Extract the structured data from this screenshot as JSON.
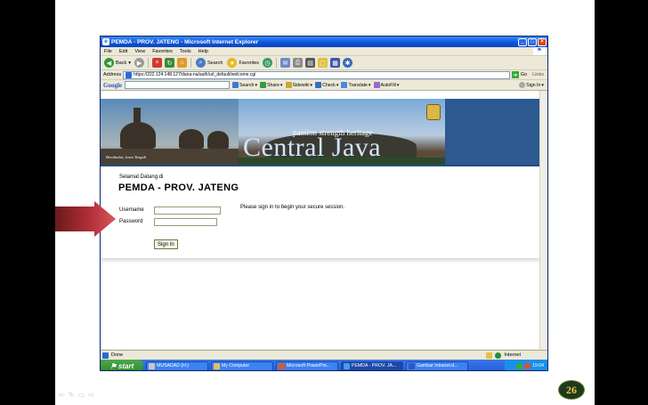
{
  "slide": {
    "page_number": "26",
    "nav_icons": [
      "⇦",
      "✎",
      "▭",
      "⇨"
    ]
  },
  "window": {
    "title": "PEMDA - PROV. JATENG - Microsoft Internet Explorer",
    "controls": [
      "_",
      "□",
      "×"
    ]
  },
  "menu": [
    "File",
    "Edit",
    "View",
    "Favorites",
    "Tools",
    "Help"
  ],
  "toolbar": {
    "back_label": "Back",
    "search_label": "Search",
    "favorites_label": "Favorites"
  },
  "address": {
    "label": "Address",
    "url": "https://222.124.148.127/dana-na/auth/url_default/welcome.cgi",
    "go_label": "Go",
    "links_label": "Links"
  },
  "google_bar": {
    "logo": "Google",
    "search_label": "Search",
    "share_label": "Share",
    "sidewiki_label": "Sidewiki",
    "check_label": "Check",
    "translate_label": "Translate",
    "autofill_label": "AutoFill",
    "signin_label": "Sign In"
  },
  "banner": {
    "caption": "Borobudur, Jawa Tengah",
    "tagline": "passion strength heritage",
    "title": "Central Java"
  },
  "login": {
    "welcome": "Selamat Datang di",
    "org_name": "PEMDA - PROV. JATENG",
    "username_label": "Username",
    "password_label": "Password",
    "username_value": "",
    "password_value": "",
    "hint": "Please sign in to begin your secure session.",
    "signin_button": "Sign In"
  },
  "status": {
    "left": "Done",
    "zone": "Internet"
  },
  "taskbar": {
    "start": "start",
    "tasks": [
      "MUSADAD (H:)",
      "My Computer",
      "Microsoft PowerPoi...",
      "PEMDA - PROV. JA...",
      "Gambar Intranet.d..."
    ],
    "clock": "19:04"
  },
  "colors": {
    "xp_blue": "#0a52d8",
    "arrow_red": "#b5303a",
    "banner_blue": "#2b5990"
  }
}
